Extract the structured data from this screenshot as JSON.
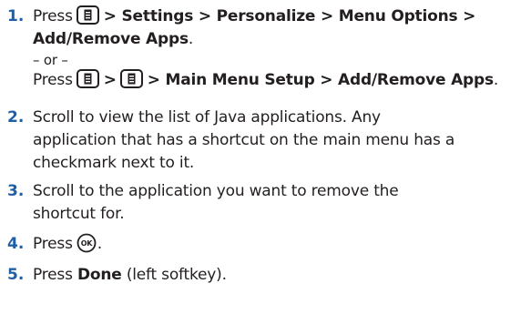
{
  "steps": [
    {
      "number": "1.",
      "press": "Press",
      "path1": "> Settings > Personalize > Menu Options >",
      "path1_end": "Add/Remove Apps",
      "period": ".",
      "or": "– or –",
      "press2": "Press",
      "path2_sep": ">",
      "path2": "> Main Menu Setup > Add/Remove Apps",
      "period2": "."
    },
    {
      "number": "2.",
      "lines": [
        "Scroll to view the list of Java applications. Any",
        "application that has a shortcut on the main menu has a",
        "checkmark next to it."
      ]
    },
    {
      "number": "3.",
      "lines": [
        "Scroll to the application you want to remove the",
        "shortcut for."
      ]
    },
    {
      "number": "4.",
      "press": "Press",
      "period": "."
    },
    {
      "number": "5.",
      "press": "Press",
      "done": "Done",
      "rest": "(left softkey)."
    }
  ],
  "icons": {
    "menu_key": "menu-key-icon",
    "ok_key": "ok-key-icon"
  },
  "colors": {
    "step_number": "#1f5fa6",
    "text": "#231f20"
  }
}
